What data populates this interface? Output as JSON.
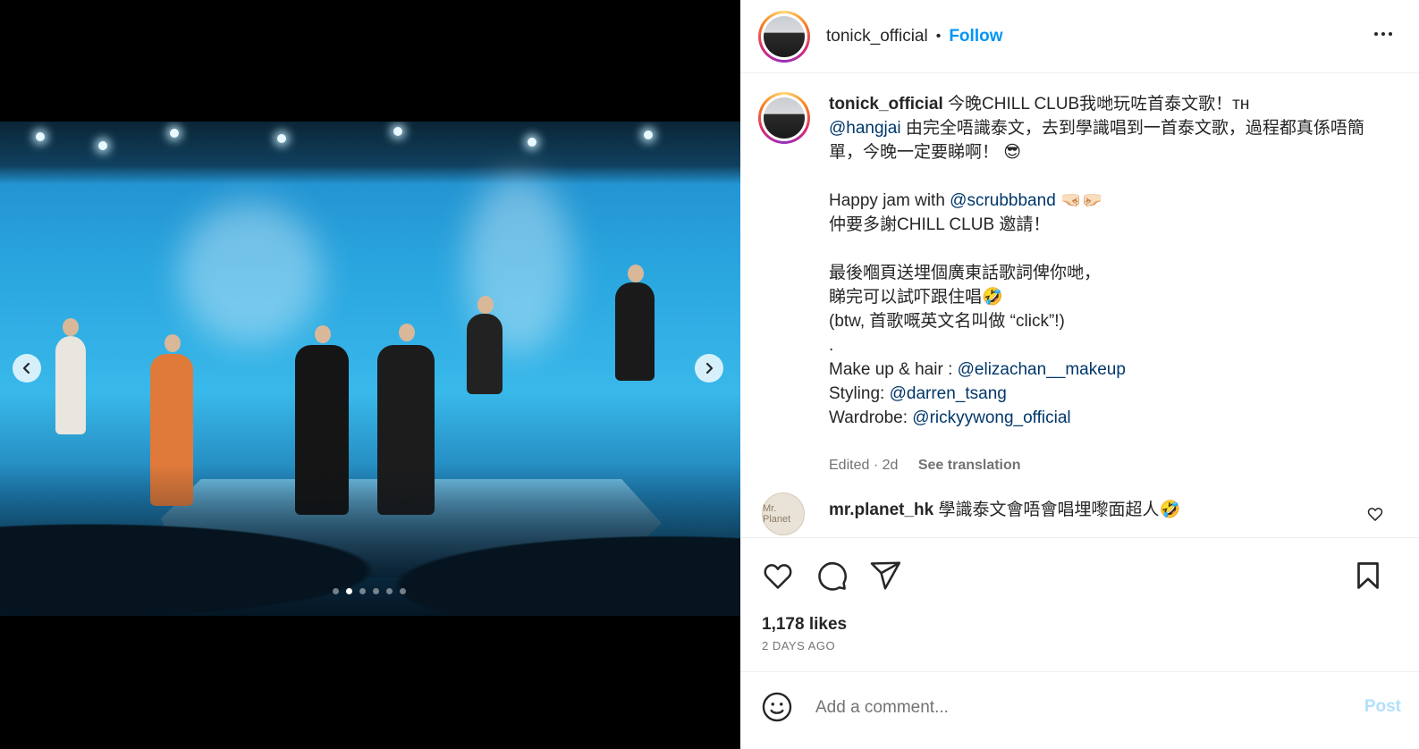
{
  "post": {
    "username": "tonick_official",
    "follow_label": "Follow",
    "more_icon": "more-horizontal-icon"
  },
  "carousel": {
    "prev_icon": "chevron-left-icon",
    "next_icon": "chevron-right-icon",
    "slide_count": 6,
    "active_slide": 2
  },
  "caption": {
    "username": "tonick_official",
    "line1": " 今晚CHILL CLUB我哋玩咗首泰文歌！ᴛʜ",
    "mention_hangjai": "@hangjai",
    "line2": " 由完全唔識泰文，去到學識唱到一首泰文歌，過程都真係唔簡單，今晚一定要睇啊！ 😎",
    "jam_text": "Happy jam with ",
    "mention_scrubb": "@scrubbband",
    "jam_emoji": " 🤜🏻🤛🏻",
    "thanks": "仲要多謝CHILL CLUB 邀請！",
    "lyrics1": "最後嗰頁送埋個廣東話歌詞俾你哋，",
    "lyrics2": "睇完可以試吓跟住唱🤣",
    "btw": "(btw, 首歌嘅英文名叫做 “click”!)",
    "dot": ".",
    "makeup_label": "Make up & hair : ",
    "makeup_mention": "@elizachan__makeup",
    "styling_label": "Styling: ",
    "styling_mention": "@darren_tsang",
    "wardrobe_label": "Wardrobe: ",
    "wardrobe_mention": "@rickyywong_official",
    "edited": "Edited · 2d",
    "see_translation": "See translation"
  },
  "comment": {
    "username": "mr.planet_hk",
    "text": " 學識泰文會唔會唱埋嚟面超人🤣",
    "avatar_text": "Mr. Planet"
  },
  "actions": {
    "likes": "1,178 likes",
    "time_ago": "2 DAYS AGO"
  },
  "add_comment": {
    "placeholder": "Add a comment...",
    "post_label": "Post"
  },
  "colors": {
    "link_blue": "#0095f6",
    "mention": "#00376b",
    "muted": "#737373",
    "post_disabled": "#b2dffc"
  }
}
